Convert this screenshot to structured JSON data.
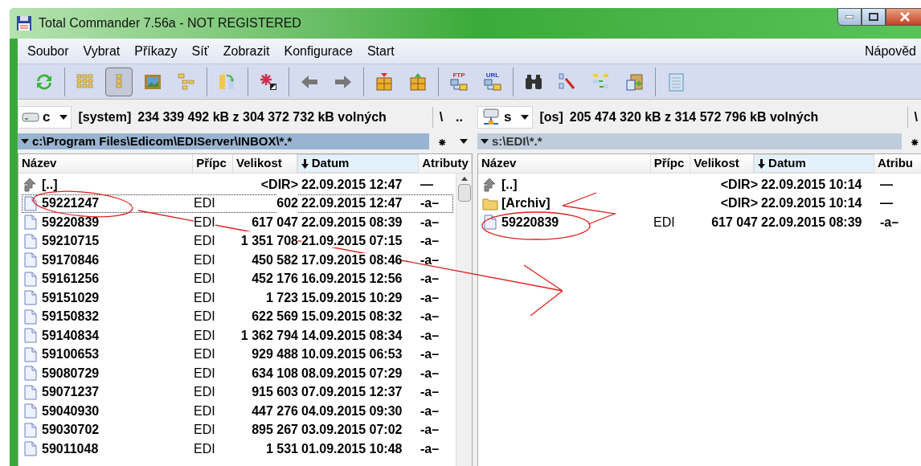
{
  "window": {
    "title": "Total Commander 7.56a - NOT REGISTERED"
  },
  "menu": [
    "Soubor",
    "Vybrat",
    "Příkazy",
    "Síť",
    "Zobrazit",
    "Konfigurace",
    "Start"
  ],
  "menu_right": "Nápověd",
  "toolbar_groups": [
    [
      {
        "kind": "refresh",
        "selected": false
      }
    ],
    [
      {
        "kind": "brief",
        "selected": false
      },
      {
        "kind": "full",
        "selected": true
      },
      {
        "kind": "thumbs",
        "selected": false
      },
      {
        "kind": "tree",
        "selected": false
      }
    ],
    [
      {
        "kind": "sync",
        "selected": false
      }
    ],
    [
      {
        "kind": "asterisk",
        "selected": false
      }
    ],
    [
      {
        "kind": "back",
        "selected": false
      },
      {
        "kind": "forward",
        "selected": false
      }
    ],
    [
      {
        "kind": "pack",
        "selected": false
      },
      {
        "kind": "unpack",
        "selected": false
      }
    ],
    [
      {
        "kind": "ftp",
        "label": "FTP",
        "selected": false
      },
      {
        "kind": "url",
        "label": "URL",
        "selected": false
      }
    ],
    [
      {
        "kind": "find",
        "selected": false
      },
      {
        "kind": "rename",
        "selected": false
      },
      {
        "kind": "compare",
        "selected": false
      },
      {
        "kind": "clipboard",
        "selected": false
      }
    ],
    [
      {
        "kind": "notepad",
        "selected": false
      }
    ]
  ],
  "panels": [
    {
      "drive": {
        "kind": "disk",
        "letter": "c"
      },
      "volume": "[system]",
      "free": "234 339 492 kB z 304 372 732 kB volných",
      "buttons": [
        "\\",
        ".."
      ],
      "path": "c:\\Program Files\\Edicom\\EDIServer\\INBOX\\*.*",
      "active": true,
      "path_button": "⁕",
      "columns": [
        {
          "label": "Název",
          "sorted": false
        },
        {
          "label": "Přípc",
          "sorted": false
        },
        {
          "label": "Velikost",
          "sorted": false
        },
        {
          "label": "Datum",
          "sorted": true
        },
        {
          "label": "Atributy",
          "sorted": false
        }
      ],
      "rows": [
        {
          "kind": "up",
          "name": "[..]",
          "size": "<DIR>",
          "date": "22.09.2015 12:47",
          "attr": "—",
          "focused": false
        },
        {
          "kind": "file",
          "name": "59221247",
          "ext": "EDI",
          "size": "602",
          "date": "22.09.2015 12:47",
          "attr": "-a–",
          "focused": true
        },
        {
          "kind": "file",
          "name": "59220839",
          "ext": "EDI",
          "size": "617 047",
          "date": "22.09.2015 08:39",
          "attr": "-a–",
          "focused": false
        },
        {
          "kind": "file",
          "name": "59210715",
          "ext": "EDI",
          "size": "1 351 708",
          "date": "21.09.2015 07:15",
          "attr": "-a–",
          "focused": false
        },
        {
          "kind": "file",
          "name": "59170846",
          "ext": "EDI",
          "size": "450 582",
          "date": "17.09.2015 08:46",
          "attr": "-a–",
          "focused": false
        },
        {
          "kind": "file",
          "name": "59161256",
          "ext": "EDI",
          "size": "452 176",
          "date": "16.09.2015 12:56",
          "attr": "-a–",
          "focused": false
        },
        {
          "kind": "file",
          "name": "59151029",
          "ext": "EDI",
          "size": "1 723",
          "date": "15.09.2015 10:29",
          "attr": "-a–",
          "focused": false
        },
        {
          "kind": "file",
          "name": "59150832",
          "ext": "EDI",
          "size": "622 569",
          "date": "15.09.2015 08:32",
          "attr": "-a–",
          "focused": false
        },
        {
          "kind": "file",
          "name": "59140834",
          "ext": "EDI",
          "size": "1 362 794",
          "date": "14.09.2015 08:34",
          "attr": "-a–",
          "focused": false
        },
        {
          "kind": "file",
          "name": "59100653",
          "ext": "EDI",
          "size": "929 488",
          "date": "10.09.2015 06:53",
          "attr": "-a–",
          "focused": false
        },
        {
          "kind": "file",
          "name": "59080729",
          "ext": "EDI",
          "size": "634 108",
          "date": "08.09.2015 07:29",
          "attr": "-a–",
          "focused": false
        },
        {
          "kind": "file",
          "name": "59071237",
          "ext": "EDI",
          "size": "915 603",
          "date": "07.09.2015 12:37",
          "attr": "-a–",
          "focused": false
        },
        {
          "kind": "file",
          "name": "59040930",
          "ext": "EDI",
          "size": "447 276",
          "date": "04.09.2015 09:30",
          "attr": "-a–",
          "focused": false
        },
        {
          "kind": "file",
          "name": "59030702",
          "ext": "EDI",
          "size": "895 267",
          "date": "03.09.2015 07:02",
          "attr": "-a–",
          "focused": false
        },
        {
          "kind": "file",
          "name": "59011048",
          "ext": "EDI",
          "size": "1 531",
          "date": "01.09.2015 10:48",
          "attr": "-a–",
          "focused": false
        }
      ]
    },
    {
      "drive": {
        "kind": "network",
        "letter": "s"
      },
      "volume": "[os]",
      "free": "205 474 320 kB z 314 572 796 kB volných",
      "buttons": [
        "\\"
      ],
      "path": "s:\\EDI\\*.*",
      "active": false,
      "path_button": "⁕",
      "columns": [
        {
          "label": "Název",
          "sorted": false
        },
        {
          "label": "Přípc",
          "sorted": false
        },
        {
          "label": "Velikost",
          "sorted": false
        },
        {
          "label": "Datum",
          "sorted": true
        },
        {
          "label": "Atribu",
          "sorted": false
        }
      ],
      "rows": [
        {
          "kind": "up",
          "name": "[..]",
          "size": "<DIR>",
          "date": "22.09.2015 10:14",
          "attr": "—",
          "focused": false
        },
        {
          "kind": "folder",
          "name": "[Archiv]",
          "size": "<DIR>",
          "date": "22.09.2015 10:14",
          "attr": "—",
          "focused": false
        },
        {
          "kind": "file",
          "name": "59220839",
          "ext": "EDI",
          "size": "617 047",
          "date": "22.09.2015 08:39",
          "attr": "-a–",
          "focused": false
        }
      ]
    }
  ]
}
